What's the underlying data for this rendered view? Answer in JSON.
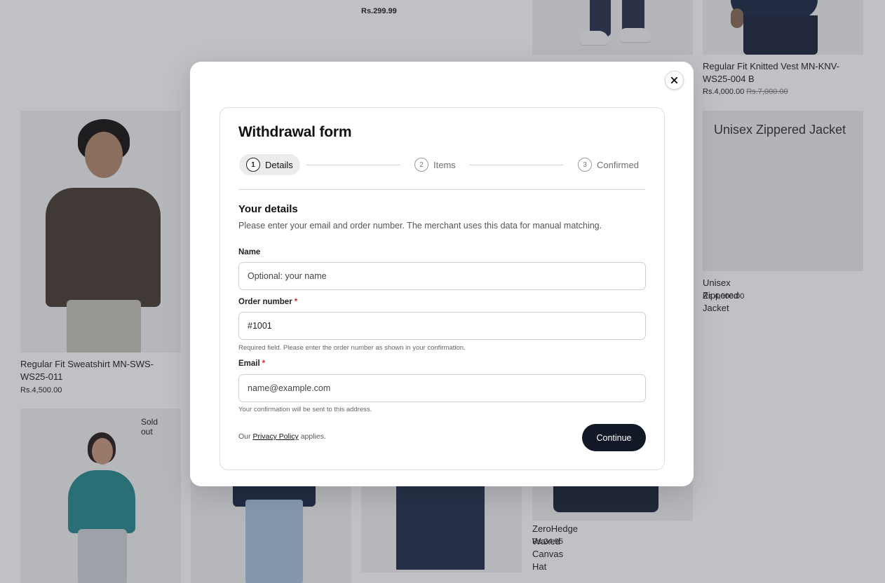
{
  "store": {
    "products": [
      {
        "title": "",
        "price": "Rs.299.99"
      },
      {
        "title": "Regular Fit Knitted Vest MN-KNV-WS25-004 B",
        "price": "Rs.4,000.00",
        "compare_price": "Rs.7,000.00"
      },
      {
        "title": "Regular Fit Sweatshirt MN-SWS-WS25-011",
        "price": "Rs.4,500.00"
      },
      {
        "title": "Unisex Zippered Jacket",
        "price": "Rs.4,000.00",
        "placeholder_text": "Unisex Zippered Jacket"
      },
      {
        "title": "ZeroHedge Waxed Canvas Hat",
        "price": "Rs.24.95"
      },
      {
        "badge": "Sold out"
      }
    ]
  },
  "modal": {
    "title": "Withdrawal form",
    "steps": [
      {
        "number": "1",
        "label": "Details",
        "active": true
      },
      {
        "number": "2",
        "label": "Items",
        "active": false
      },
      {
        "number": "3",
        "label": "Confirmed",
        "active": false
      }
    ],
    "section_title": "Your details",
    "section_description": "Please enter your email and order number. The merchant uses this data for manual matching.",
    "fields": {
      "name": {
        "label": "Name",
        "placeholder": "Optional: your name",
        "value": ""
      },
      "order_number": {
        "label": "Order number",
        "required_mark": "*",
        "value": "#1001",
        "hint": "Required field. Please enter the order number as shown in your confirmation."
      },
      "email": {
        "label": "Email",
        "required_mark": "*",
        "placeholder": "name@example.com",
        "value": "",
        "hint": "Your confirmation will be sent to this address."
      }
    },
    "policy": {
      "prefix": "Our",
      "link": "Privacy Policy",
      "suffix": "applies."
    },
    "continue_label": "Continue",
    "close_icon": "close-icon"
  },
  "colors": {
    "overlay": "#2a3242",
    "primary_button": "#121826",
    "required": "#d62828"
  }
}
